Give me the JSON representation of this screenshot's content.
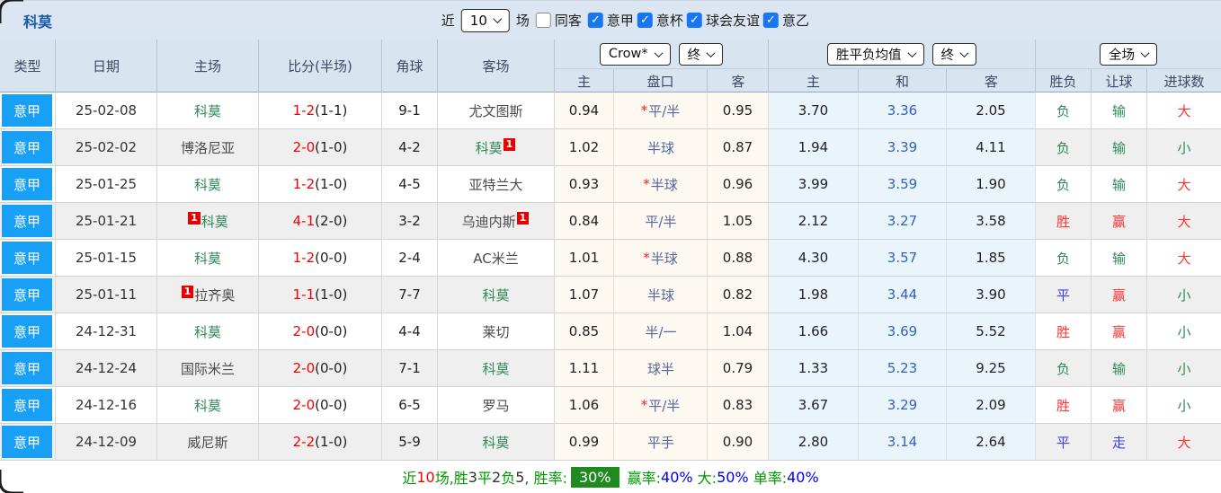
{
  "title": "科莫",
  "filter_bar": {
    "recent_label": "近",
    "matches_select": "10",
    "matches_label": "场",
    "same_away": {
      "label": "同客",
      "checked": false
    },
    "leagues": [
      {
        "label": "意甲",
        "checked": true
      },
      {
        "label": "意杯",
        "checked": true
      },
      {
        "label": "球会友谊",
        "checked": true
      },
      {
        "label": "意乙",
        "checked": true
      }
    ]
  },
  "header": {
    "cols": [
      "类型",
      "日期",
      "主场",
      "比分(半场)",
      "角球",
      "客场"
    ],
    "odds_company": "Crow*",
    "odds_time": "终",
    "odds_cols": [
      "主",
      "盘口",
      "客"
    ],
    "euro_company": "胜平负均值",
    "euro_time": "终",
    "euro_cols": [
      "主",
      "和",
      "客"
    ],
    "result_select": "全场",
    "result_cols": [
      "胜负",
      "让球",
      "进球数"
    ]
  },
  "icons": {
    "star": "*",
    "checkmark": "✓"
  },
  "colors": {
    "accent_blue": "#18a0f6",
    "team_green": "#2e8b57",
    "result_red": "#ff3232",
    "result_blue": "#3c3cff",
    "summary_badge_green": "#1f8b1f"
  },
  "rows": [
    {
      "league": "意甲",
      "date": "25-02-08",
      "home": "科莫",
      "home_green": true,
      "home_badge": "",
      "home_badge_pos": "",
      "away": "尤文图斯",
      "away_green": false,
      "away_badge": "",
      "away_badge_pos": "",
      "score": "1-2",
      "half": "(1-1)",
      "corner": "9-1",
      "ah_home": "0.94",
      "ah_star": true,
      "ah_line": "平/半",
      "ah_away": "0.95",
      "eu_home": "3.70",
      "eu_draw": "3.36",
      "eu_away": "2.05",
      "res_wdl": {
        "t": "负",
        "c": "green"
      },
      "res_ah": {
        "t": "输",
        "c": "green"
      },
      "res_goals": {
        "t": "大",
        "c": "red"
      }
    },
    {
      "league": "意甲",
      "date": "25-02-02",
      "home": "博洛尼亚",
      "home_green": false,
      "home_badge": "",
      "home_badge_pos": "",
      "away": "科莫",
      "away_green": true,
      "away_badge": "1",
      "away_badge_pos": "after",
      "score": "2-0",
      "half": "(1-0)",
      "corner": "4-2",
      "ah_home": "1.02",
      "ah_star": false,
      "ah_line": "半球",
      "ah_away": "0.87",
      "eu_home": "1.94",
      "eu_draw": "3.39",
      "eu_away": "4.11",
      "res_wdl": {
        "t": "负",
        "c": "green"
      },
      "res_ah": {
        "t": "输",
        "c": "green"
      },
      "res_goals": {
        "t": "小",
        "c": "green"
      }
    },
    {
      "league": "意甲",
      "date": "25-01-25",
      "home": "科莫",
      "home_green": true,
      "home_badge": "",
      "home_badge_pos": "",
      "away": "亚特兰大",
      "away_green": false,
      "away_badge": "",
      "away_badge_pos": "",
      "score": "1-2",
      "half": "(1-0)",
      "corner": "4-5",
      "ah_home": "0.93",
      "ah_star": true,
      "ah_line": "半球",
      "ah_away": "0.96",
      "eu_home": "3.99",
      "eu_draw": "3.59",
      "eu_away": "1.90",
      "res_wdl": {
        "t": "负",
        "c": "green"
      },
      "res_ah": {
        "t": "输",
        "c": "green"
      },
      "res_goals": {
        "t": "大",
        "c": "red"
      }
    },
    {
      "league": "意甲",
      "date": "25-01-21",
      "home": "科莫",
      "home_green": true,
      "home_badge": "1",
      "home_badge_pos": "before",
      "away": "乌迪内斯",
      "away_green": false,
      "away_badge": "1",
      "away_badge_pos": "after",
      "score": "4-1",
      "half": "(2-0)",
      "corner": "3-2",
      "ah_home": "0.84",
      "ah_star": false,
      "ah_line": "平/半",
      "ah_away": "1.05",
      "eu_home": "2.12",
      "eu_draw": "3.27",
      "eu_away": "3.58",
      "res_wdl": {
        "t": "胜",
        "c": "red"
      },
      "res_ah": {
        "t": "赢",
        "c": "red"
      },
      "res_goals": {
        "t": "大",
        "c": "red"
      }
    },
    {
      "league": "意甲",
      "date": "25-01-15",
      "home": "科莫",
      "home_green": true,
      "home_badge": "",
      "home_badge_pos": "",
      "away": "AC米兰",
      "away_green": false,
      "away_badge": "",
      "away_badge_pos": "",
      "score": "1-2",
      "half": "(0-0)",
      "corner": "2-4",
      "ah_home": "1.01",
      "ah_star": true,
      "ah_line": "半球",
      "ah_away": "0.88",
      "eu_home": "4.30",
      "eu_draw": "3.57",
      "eu_away": "1.85",
      "res_wdl": {
        "t": "负",
        "c": "green"
      },
      "res_ah": {
        "t": "输",
        "c": "green"
      },
      "res_goals": {
        "t": "大",
        "c": "red"
      }
    },
    {
      "league": "意甲",
      "date": "25-01-11",
      "home": "拉齐奥",
      "home_green": false,
      "home_badge": "1",
      "home_badge_pos": "before",
      "away": "科莫",
      "away_green": true,
      "away_badge": "",
      "away_badge_pos": "",
      "score": "1-1",
      "half": "(1-0)",
      "corner": "7-7",
      "ah_home": "1.07",
      "ah_star": false,
      "ah_line": "半球",
      "ah_away": "0.82",
      "eu_home": "1.98",
      "eu_draw": "3.44",
      "eu_away": "3.90",
      "res_wdl": {
        "t": "平",
        "c": "blue"
      },
      "res_ah": {
        "t": "赢",
        "c": "red"
      },
      "res_goals": {
        "t": "小",
        "c": "green"
      }
    },
    {
      "league": "意甲",
      "date": "24-12-31",
      "home": "科莫",
      "home_green": true,
      "home_badge": "",
      "home_badge_pos": "",
      "away": "莱切",
      "away_green": false,
      "away_badge": "",
      "away_badge_pos": "",
      "score": "2-0",
      "half": "(0-0)",
      "corner": "4-4",
      "ah_home": "0.85",
      "ah_star": false,
      "ah_line": "半/一",
      "ah_away": "1.04",
      "eu_home": "1.66",
      "eu_draw": "3.69",
      "eu_away": "5.52",
      "res_wdl": {
        "t": "胜",
        "c": "red"
      },
      "res_ah": {
        "t": "赢",
        "c": "red"
      },
      "res_goals": {
        "t": "小",
        "c": "green"
      }
    },
    {
      "league": "意甲",
      "date": "24-12-24",
      "home": "国际米兰",
      "home_green": false,
      "home_badge": "",
      "home_badge_pos": "",
      "away": "科莫",
      "away_green": true,
      "away_badge": "",
      "away_badge_pos": "",
      "score": "2-0",
      "half": "(0-0)",
      "corner": "7-1",
      "ah_home": "1.11",
      "ah_star": false,
      "ah_line": "球半",
      "ah_away": "0.79",
      "eu_home": "1.33",
      "eu_draw": "5.23",
      "eu_away": "9.25",
      "res_wdl": {
        "t": "负",
        "c": "green"
      },
      "res_ah": {
        "t": "输",
        "c": "green"
      },
      "res_goals": {
        "t": "小",
        "c": "green"
      }
    },
    {
      "league": "意甲",
      "date": "24-12-16",
      "home": "科莫",
      "home_green": true,
      "home_badge": "",
      "home_badge_pos": "",
      "away": "罗马",
      "away_green": false,
      "away_badge": "",
      "away_badge_pos": "",
      "score": "2-0",
      "half": "(0-0)",
      "corner": "6-5",
      "ah_home": "1.06",
      "ah_star": true,
      "ah_line": "平/半",
      "ah_away": "0.83",
      "eu_home": "3.67",
      "eu_draw": "3.29",
      "eu_away": "2.09",
      "res_wdl": {
        "t": "胜",
        "c": "red"
      },
      "res_ah": {
        "t": "赢",
        "c": "red"
      },
      "res_goals": {
        "t": "小",
        "c": "green"
      }
    },
    {
      "league": "意甲",
      "date": "24-12-09",
      "home": "威尼斯",
      "home_green": false,
      "home_badge": "",
      "home_badge_pos": "",
      "away": "科莫",
      "away_green": true,
      "away_badge": "",
      "away_badge_pos": "",
      "score": "2-2",
      "half": "(1-0)",
      "corner": "5-9",
      "ah_home": "0.99",
      "ah_star": false,
      "ah_line": "平手",
      "ah_away": "0.90",
      "eu_home": "2.80",
      "eu_draw": "3.14",
      "eu_away": "2.64",
      "res_wdl": {
        "t": "平",
        "c": "blue"
      },
      "res_ah": {
        "t": "走",
        "c": "blue"
      },
      "res_goals": {
        "t": "大",
        "c": "red"
      }
    }
  ],
  "summary": {
    "segments": [
      {
        "t": "近",
        "c": "green"
      },
      {
        "t": "10",
        "c": "red"
      },
      {
        "t": "场,",
        "c": "green"
      },
      {
        "t": "胜",
        "c": "green"
      },
      {
        "t": "3",
        "c": "black"
      },
      {
        "t": "平",
        "c": "green"
      },
      {
        "t": "2",
        "c": "black"
      },
      {
        "t": "负",
        "c": "green"
      },
      {
        "t": "5",
        "c": "black"
      },
      {
        "t": ", 胜率:",
        "c": "green"
      },
      {
        "t": "30%",
        "c": "badge"
      },
      {
        "t": " 赢率:",
        "c": "green"
      },
      {
        "t": "40%",
        "c": "blue"
      },
      {
        "t": " 大:",
        "c": "green"
      },
      {
        "t": "50%",
        "c": "blue"
      },
      {
        "t": " 单率:",
        "c": "green"
      },
      {
        "t": "40%",
        "c": "blue"
      }
    ]
  }
}
